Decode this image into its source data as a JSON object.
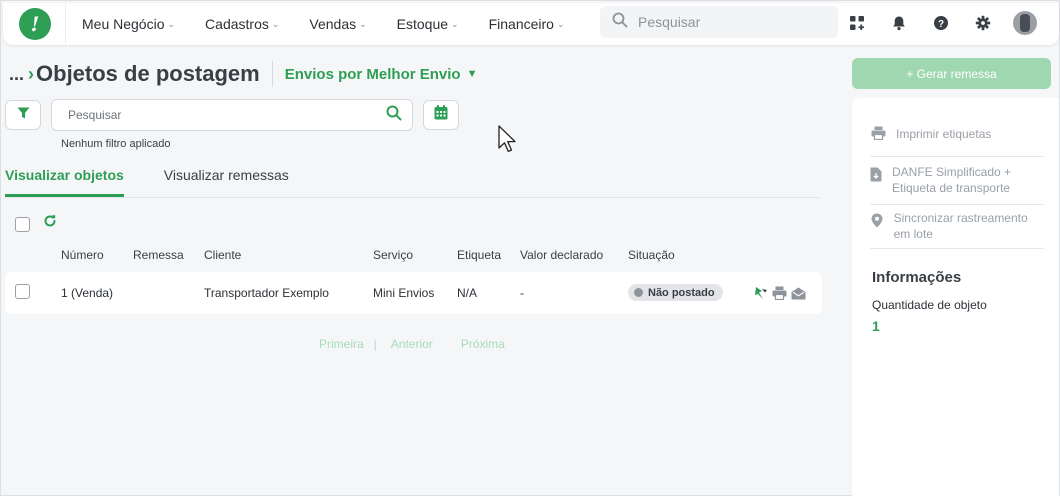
{
  "nav": {
    "items": [
      {
        "label": "Meu Negócio"
      },
      {
        "label": "Cadastros"
      },
      {
        "label": "Vendas"
      },
      {
        "label": "Estoque"
      },
      {
        "label": "Financeiro"
      }
    ],
    "search_placeholder": "Pesquisar",
    "icons": [
      "apps-icon",
      "bell-icon",
      "help-icon",
      "gear-icon",
      "avatar"
    ]
  },
  "header": {
    "breadcrumb_ellipsis": "...",
    "title": "Objetos de postagem",
    "subtitle": "Envios por Melhor Envio",
    "generate_button": "+ Gerar remessa"
  },
  "filters": {
    "search_placeholder": "Pesquisar",
    "no_filter_text": "Nenhum filtro aplicado"
  },
  "tabs": [
    {
      "label": "Visualizar objetos",
      "active": true
    },
    {
      "label": "Visualizar remessas",
      "active": false
    }
  ],
  "table": {
    "columns": [
      "Número",
      "Remessa",
      "Cliente",
      "Serviço",
      "Etiqueta",
      "Valor declarado",
      "Situação"
    ],
    "rows": [
      {
        "numero": "1 (Venda)",
        "remessa": "",
        "cliente": "Transportador Exemplo",
        "servico": "Mini Envios",
        "etiqueta": "N/A",
        "valor": "-",
        "situacao": "Não postado"
      }
    ]
  },
  "pager": {
    "first": "Primeira",
    "separator": "|",
    "prev": "Anterior",
    "next": "Próxima"
  },
  "panel": {
    "actions": [
      {
        "label": "Imprimir etiquetas"
      },
      {
        "label": "DANFE Simplificado + Etiqueta de transporte"
      },
      {
        "label": "Sincronizar rastreamento em lote"
      }
    ],
    "info_title": "Informações",
    "info_label": "Quantidade de objeto",
    "info_value": "1"
  },
  "colors": {
    "accent": "#2e9e55",
    "accent_light": "#9fd8b0",
    "text": "#3a3f45",
    "muted": "#9aa0a6"
  }
}
